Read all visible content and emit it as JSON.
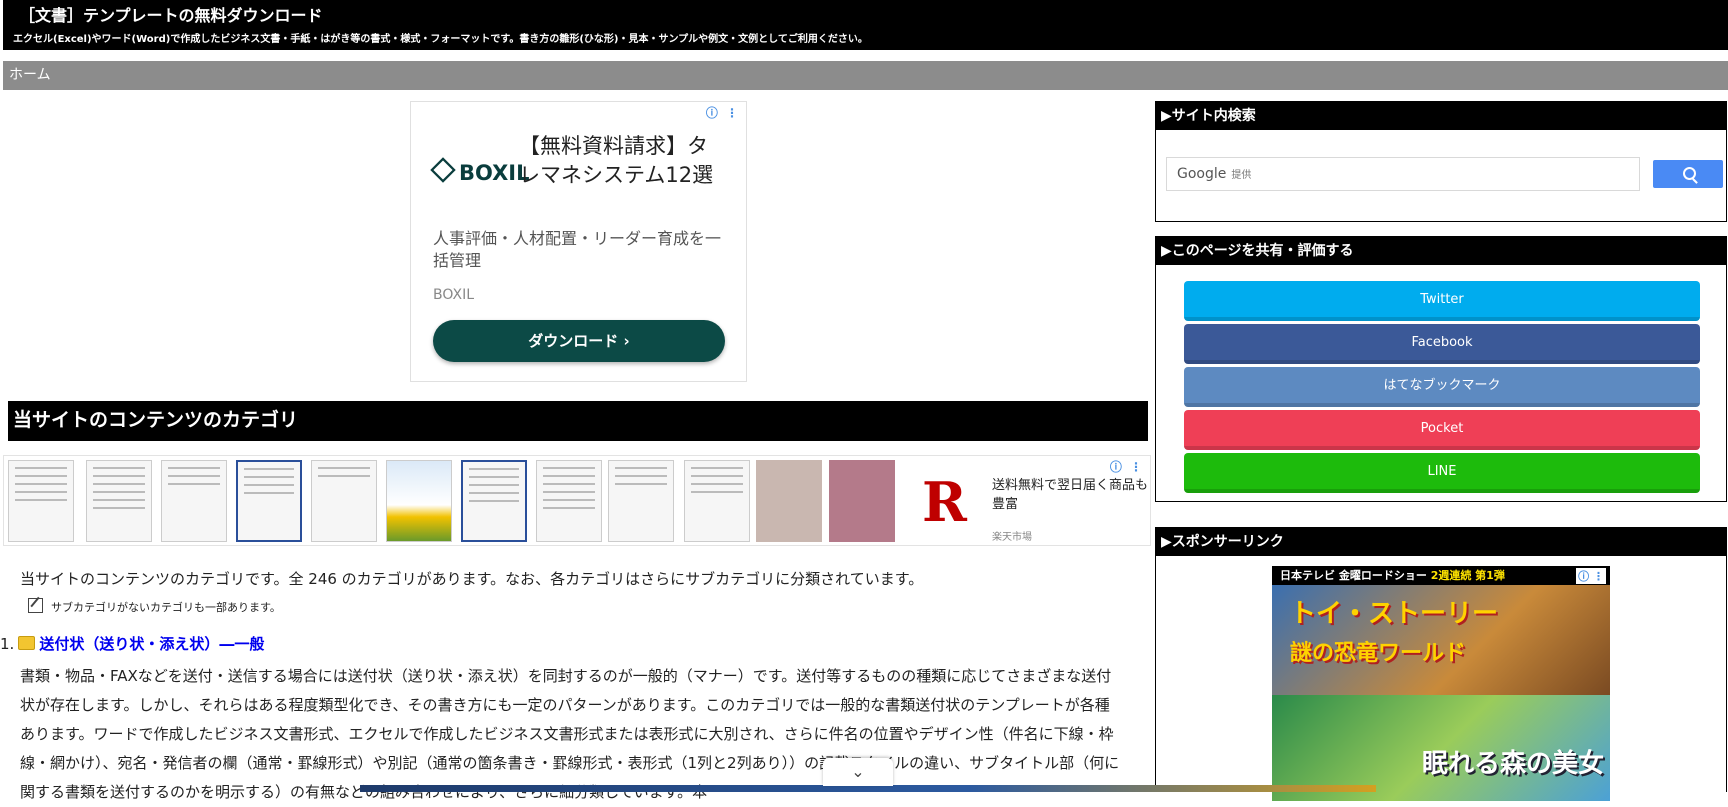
{
  "header": {
    "title": "［文書］テンプレートの無料ダウンロード",
    "description": "エクセル(Excel)やワード(Word)で作成したビジネス文書・手紙・はがき等の書式・様式・フォーマットです。書き方の雛形(ひな形)・見本・サンプルや例文・文例としてご利用ください。"
  },
  "breadcrumb": {
    "home": "ホーム"
  },
  "ad_top": {
    "choices": "ⓘ ⋮",
    "logo": "BOXIL",
    "headline": "【無料資料請求】タレマネシステム12選",
    "body": "人事評価・人材配置・リーダー育成を一括管理",
    "advertiser": "BOXIL",
    "cta": "ダウンロード ›"
  },
  "section": {
    "heading": "当サイトのコンテンツのカテゴリ"
  },
  "ad_strip": {
    "choices": "ⓘ ⋮",
    "logo": "R",
    "text": "送料無料で翌日届く商品も豊富",
    "advertiser": "楽天市場"
  },
  "content": {
    "intro": "当サイトのコンテンツのカテゴリです。全 246 のカテゴリがあります。なお、各カテゴリはさらにサブカテゴリに分類されています。",
    "note": "サブカテゴリがないカテゴリも一部あります。",
    "category_number": "1.",
    "category_title": "送付状（送り状・添え状）―一般",
    "category_desc": "書類・物品・FAXなどを送付・送信する場合には送付状（送り状・添え状）を同封するのが一般的（マナー）です。送付等するものの種類に応じてさまざまな送付状が存在します。しかし、それらはある程度類型化でき、その書き方にも一定のパターンがあります。このカテゴリでは一般的な書類送付状のテンプレートが各種あります。ワードで作成したビジネス文書形式、エクセルで作成したビジネス文書形式または表形式に大別され、さらに件名の位置やデザイン性（件名に下線・枠線・網かけ）、宛名・発信者の欄（通常・罫線形式）や別記（通常の箇条書き・罫線形式・表形式（1列と2列あり））の記載スタイルの違い、サブタイトル部（何に関する書類を送付するのかを明示する）の有無などの組み合わせにより、さらに細分類しています。本"
  },
  "sidebar": {
    "search": {
      "title": "▶サイト内検索",
      "google": "Google",
      "provided": "提供"
    },
    "share": {
      "title": "▶このページを共有・評価する",
      "buttons": [
        {
          "label": "Twitter",
          "color": "#00acee"
        },
        {
          "label": "Facebook",
          "color": "#3b5998"
        },
        {
          "label": "はてなブックマーク",
          "color": "#5d8ac1"
        },
        {
          "label": "Pocket",
          "color": "#ef3f56"
        },
        {
          "label": "LINE",
          "color": "#1dbb0c"
        }
      ]
    },
    "sponsor": {
      "title": "▶スポンサーリンク",
      "banner_prefix": "日本テレビ 金曜ロードショー",
      "banner_highlight": "2週連続 第1弾",
      "movie1_line1": "トイ・ストーリー",
      "movie1_line2": "謎の恐竜ワールド",
      "movie2": "眠れる森の美女",
      "choices": "ⓘ ⋮"
    }
  },
  "overlay": {
    "collapse": "⌄"
  }
}
